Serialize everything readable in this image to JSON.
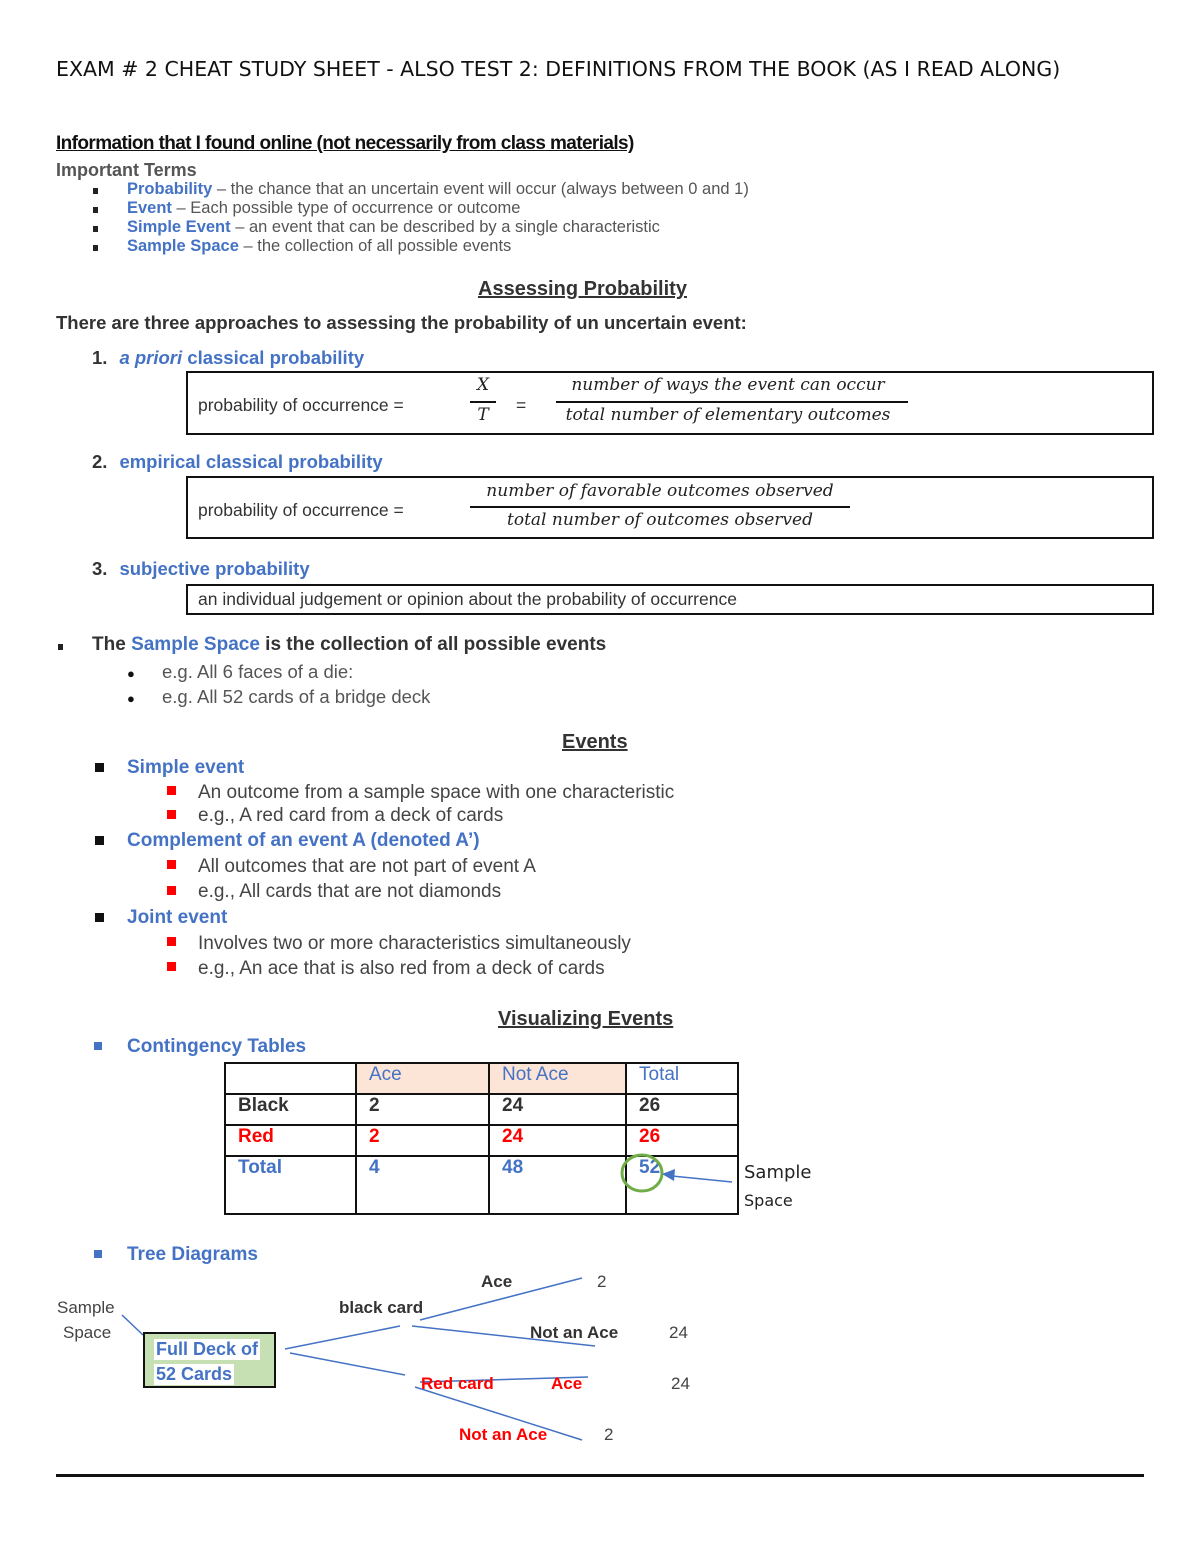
{
  "title": "EXAM # 2 CHEAT STUDY SHEET - ALSO TEST 2: DEFINITIONS FROM THE BOOK (AS I READ ALONG)",
  "online_heading": "Information that I found online (not necessarily from class materials)",
  "important_terms": {
    "heading": "Important Terms",
    "items": [
      {
        "term": "Probability",
        "definition": " – the chance that an uncertain event will occur (always between 0 and 1)"
      },
      {
        "term": "Event",
        "definition": " – Each possible type of occurrence or outcome"
      },
      {
        "term": "Simple Event",
        "definition": " – an event that can be described by a single characteristic"
      },
      {
        "term": "Sample Space",
        "definition": " – the collection of all possible events"
      }
    ]
  },
  "assessing": {
    "heading": "Assessing Probability",
    "intro": "There are three approaches to assessing the probability of un uncertain event:",
    "approaches": [
      {
        "number": "1.",
        "label_italic": "a priori",
        "label": " classical probability",
        "formula_lhs": "probability of occurrence =",
        "x": "X",
        "t": "T",
        "eq": "=",
        "numerator": "number of ways the event can occur",
        "denominator": "total number of elementary outcomes"
      },
      {
        "number": "2.",
        "label": "empirical classical probability",
        "formula_lhs": "probability of occurrence =",
        "numerator": "number of favorable outcomes observed",
        "denominator": "total number of outcomes observed"
      },
      {
        "number": "3.",
        "label": "subjective probability",
        "text": "an individual judgement or opinion about the probability of occurrence"
      }
    ]
  },
  "sample_space": {
    "prefix": "The ",
    "term": "Sample Space",
    "suffix": " is the collection of all possible events",
    "examples": [
      "e.g. All 6 faces of a die:",
      "e.g. All 52 cards of a bridge deck"
    ]
  },
  "events": {
    "heading": "Events",
    "items": [
      {
        "label": "Simple event",
        "subs": [
          "An outcome from a sample space with one characteristic",
          "e.g., A red card from a deck of cards"
        ]
      },
      {
        "label": "Complement of an event A (denoted A’)",
        "subs": [
          "All outcomes that are not part of event A",
          "e.g., All cards that are not diamonds"
        ]
      },
      {
        "label": "Joint event",
        "subs": [
          "Involves two or more characteristics simultaneously",
          "e.g., An ace that is also red from a deck of cards"
        ]
      }
    ]
  },
  "visualizing": {
    "heading": "Visualizing Events",
    "contingency_label": "Contingency Tables",
    "table": {
      "headers": [
        "",
        "Ace",
        "Not Ace",
        "Total"
      ],
      "rows": [
        [
          "Black",
          "2",
          "24",
          "26"
        ],
        [
          "Red",
          "2",
          "24",
          "26"
        ],
        [
          "Total",
          "4",
          "48",
          "52"
        ]
      ]
    },
    "sample_space_annotation": [
      "Sample",
      "Space"
    ],
    "tree_label": "Tree Diagrams",
    "tree": {
      "sample_space_label": [
        "Sample",
        "Space"
      ],
      "root": [
        "Full Deck of",
        "52 Cards"
      ],
      "black_card": "black card",
      "red_card": "Red card",
      "black_ace": "Ace",
      "black_ace_count": "2",
      "black_not_ace": "Not an Ace",
      "black_not_ace_count": "24",
      "red_ace": "Ace",
      "red_ace_count": "24",
      "red_not_ace": "Not an Ace",
      "red_not_ace_count": "2"
    }
  },
  "colors": {
    "accent_blue": "#4472c4",
    "red": "#ff0000",
    "header_fill": "#fce4d6",
    "root_fill": "#c6e0b4",
    "circle_green": "#70ad47"
  }
}
